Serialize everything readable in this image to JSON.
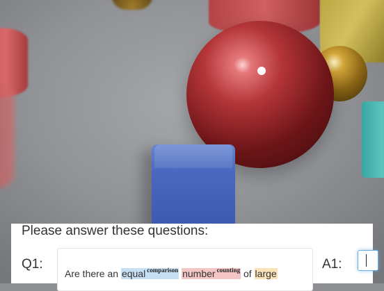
{
  "scene": {
    "objects": [
      "red-metal-sphere",
      "blue-rubber-cube",
      "gold-metal-sphere",
      "gold-metal-cube",
      "cyan-rubber-cube",
      "red-rubber-cylinder",
      "gold-small-cylinder"
    ]
  },
  "panel": {
    "title": "Please answer these questions:",
    "questions": [
      {
        "label": "Q1:",
        "tokens": [
          {
            "text": "Are there an ",
            "tag": ""
          },
          {
            "text": "equal",
            "tag": "comparison"
          },
          {
            "text": " ",
            "tag": ""
          },
          {
            "text": "number",
            "tag": "counting"
          },
          {
            "text": " of ",
            "tag": ""
          },
          {
            "text": "large",
            "tag": ""
          }
        ],
        "answer_label": "A1:",
        "answer_value": ""
      }
    ]
  },
  "colors": {
    "comparison": "#c7dff3",
    "counting": "#f4c5c5",
    "size": "#fbe2b8",
    "focus_border": "#66afe9"
  }
}
